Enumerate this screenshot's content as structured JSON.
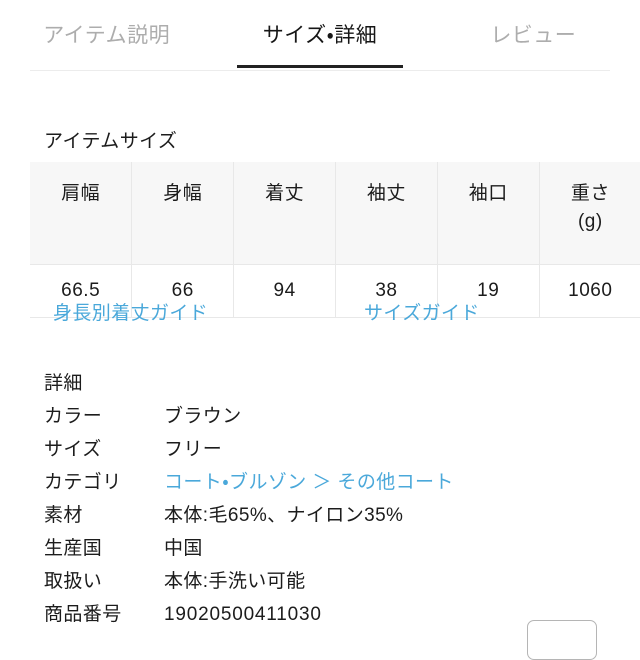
{
  "tabs": [
    {
      "label": "アイテム説明",
      "active": false,
      "name": "tab-item-description"
    },
    {
      "label": "サイズ・詳細",
      "active": true,
      "name": "tab-size-detail"
    },
    {
      "label": "レビュー",
      "active": false,
      "name": "tab-reviews"
    }
  ],
  "size_section": {
    "heading": "アイテムサイズ",
    "columns": [
      "肩幅",
      "身幅",
      "着丈",
      "袖丈",
      "袖口",
      "重さ\n(g)"
    ],
    "columns_display": [
      "肩幅",
      "身幅",
      "着丈",
      "袖丈",
      "袖口",
      "重さ (g)"
    ],
    "column_lines": [
      [
        "肩幅"
      ],
      [
        "身幅"
      ],
      [
        "着丈"
      ],
      [
        "袖丈"
      ],
      [
        "袖口"
      ],
      [
        "重さ",
        "(g)"
      ]
    ],
    "values": [
      "66.5",
      "66",
      "94",
      "38",
      "19",
      "1060"
    ],
    "guide_links": [
      {
        "label": "身長別着丈ガイド",
        "name": "height-length-guide-link"
      },
      {
        "label": "サイズガイド",
        "name": "size-guide-link"
      }
    ]
  },
  "detail_section": {
    "heading": "詳細",
    "rows": [
      {
        "label": "カラー",
        "value": "ブラウン",
        "is_link": false
      },
      {
        "label": "サイズ",
        "value": "フリー",
        "is_link": false
      },
      {
        "label": "カテゴリ",
        "value": "コート・ブルゾン ＞ その他コート",
        "is_link": true
      },
      {
        "label": "素材",
        "value": "本体:毛65%、ナイロン35%",
        "is_link": false
      },
      {
        "label": "生産国",
        "value": "中国",
        "is_link": false
      },
      {
        "label": "取扱い",
        "value": "本体:手洗い可能",
        "is_link": false
      },
      {
        "label": "商品番号",
        "value": "19020500411030",
        "is_link": false
      }
    ]
  },
  "bottom_button": {
    "label": ""
  },
  "colors": {
    "link_blue": "#4aa8da",
    "active_tab": "#161616",
    "inactive_tab": "#adadad",
    "table_header_bg": "#f7f7f7",
    "border": "#e8e8e8"
  }
}
